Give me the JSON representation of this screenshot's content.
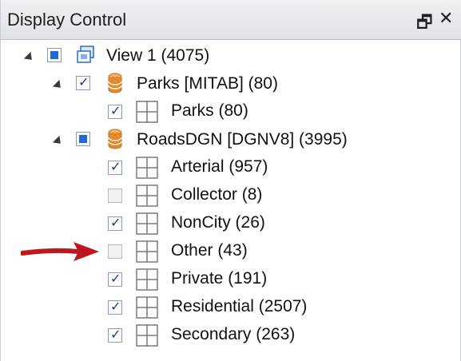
{
  "panel": {
    "title": "Display Control",
    "pin_icon": "🗗",
    "close_icon": "✕"
  },
  "tree": {
    "view": {
      "label": "View 1 (4075)",
      "state": "partial"
    },
    "layer_parks": {
      "label": "Parks [MITAB] (80)",
      "state": "checked"
    },
    "parks_items": [
      {
        "label": "Parks (80)",
        "state": "checked"
      }
    ],
    "layer_roads": {
      "label": "RoadsDGN [DGNV8] (3995)",
      "state": "partial"
    },
    "roads_items": [
      {
        "label": "Arterial (957)",
        "state": "checked"
      },
      {
        "label": "Collector (8)",
        "state": "unchecked"
      },
      {
        "label": "NonCity (26)",
        "state": "checked"
      },
      {
        "label": "Other (43)",
        "state": "unchecked"
      },
      {
        "label": "Private (191)",
        "state": "checked"
      },
      {
        "label": "Residential (2507)",
        "state": "checked"
      },
      {
        "label": "Secondary (263)",
        "state": "checked"
      }
    ]
  },
  "colors": {
    "arrow": "#c0161d",
    "db_icon": "#e18a2e",
    "check": "#1f3a8a",
    "partial": "#1e6bd6"
  }
}
